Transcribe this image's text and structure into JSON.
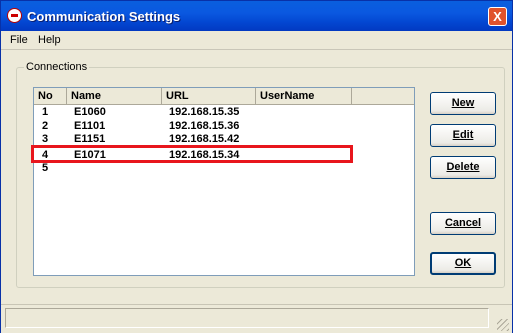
{
  "window": {
    "title": "Communication Settings",
    "close_label": "X"
  },
  "menu": [
    {
      "label": "File"
    },
    {
      "label": "Help"
    }
  ],
  "connections": {
    "group_label": "Connections",
    "columns": [
      "No",
      "Name",
      "URL",
      "UserName"
    ],
    "rows": [
      {
        "no": "1",
        "name": "E1060",
        "url": "192.168.15.35",
        "username": ""
      },
      {
        "no": "2",
        "name": "E1101",
        "url": "192.168.15.36",
        "username": ""
      },
      {
        "no": "3",
        "name": "E1151",
        "url": "192.168.15.42",
        "username": ""
      },
      {
        "no": "4",
        "name": "E1071",
        "url": "192.168.15.34",
        "username": ""
      },
      {
        "no": "5",
        "name": "",
        "url": "",
        "username": ""
      }
    ],
    "highlighted_row": "4"
  },
  "buttons": {
    "new": "New",
    "edit": "Edit",
    "delete": "Delete",
    "cancel": "Cancel",
    "ok": "OK"
  },
  "colors": {
    "title_bar": "#0a5fde",
    "highlight_border": "#e8161c"
  }
}
